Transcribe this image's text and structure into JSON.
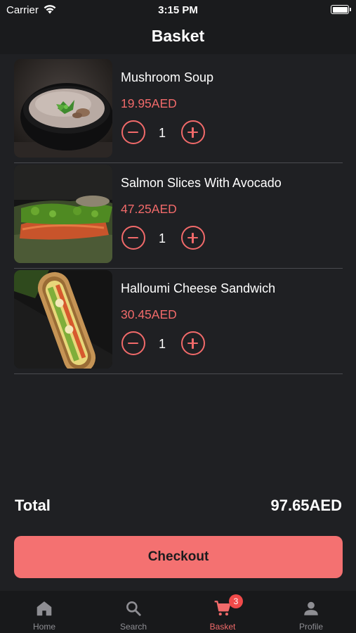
{
  "status_bar": {
    "carrier": "Carrier",
    "time": "3:15 PM"
  },
  "header": {
    "title": "Basket"
  },
  "items": [
    {
      "name": "Mushroom Soup",
      "price": "19.95AED",
      "quantity": "1",
      "image": "mushroom-soup-photo"
    },
    {
      "name": "Salmon Slices With Avocado",
      "price": "47.25AED",
      "quantity": "1",
      "image": "salmon-avocado-photo"
    },
    {
      "name": "Halloumi Cheese Sandwich",
      "price": "30.45AED",
      "quantity": "1",
      "image": "halloumi-sandwich-photo"
    }
  ],
  "summary": {
    "total_label": "Total",
    "total_value": "97.65AED"
  },
  "checkout": {
    "label": "Checkout"
  },
  "tabs": [
    {
      "label": "Home",
      "icon": "home-icon",
      "active": false
    },
    {
      "label": "Search",
      "icon": "search-icon",
      "active": false
    },
    {
      "label": "Basket",
      "icon": "cart-icon",
      "active": true,
      "badge": "3"
    },
    {
      "label": "Profile",
      "icon": "person-icon",
      "active": false
    }
  ],
  "colors": {
    "accent": "#f47171",
    "price": "#f16a6a",
    "background": "#1f2023",
    "bar": "#1a1b1d"
  }
}
